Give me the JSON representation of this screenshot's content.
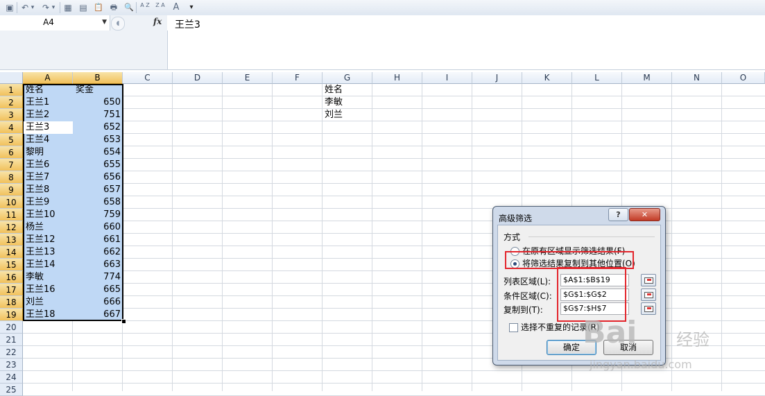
{
  "toolbar": {
    "icons": [
      "save-icon",
      "undo-icon",
      "undo-dropdown-icon",
      "redo-icon",
      "redo-dropdown-icon",
      "borders-icon",
      "form-icon",
      "paste-icon",
      "print-icon",
      "print-preview-icon",
      "sort-ascending-icon",
      "sort-descending-icon",
      "font-size-icon",
      "customize-icon"
    ],
    "glyphs": [
      "▣",
      "↶",
      "▾",
      "↷",
      "▾",
      "▦",
      "▤",
      "📋",
      "🖶",
      "🔍",
      "↓",
      "↓",
      "A",
      "▾"
    ],
    "sort_asc_label": "A Z",
    "sort_desc_label": "Z A",
    "font_label": "A"
  },
  "formula_bar": {
    "name_box": "A4",
    "fx_label": "fx",
    "content": "王兰3"
  },
  "grid": {
    "columns": [
      "A",
      "B",
      "C",
      "D",
      "E",
      "F",
      "G",
      "H",
      "I",
      "J",
      "K",
      "L",
      "M",
      "N",
      "O"
    ],
    "rows": [
      "1",
      "2",
      "3",
      "4",
      "5",
      "6",
      "7",
      "8",
      "9",
      "10",
      "11",
      "12",
      "13",
      "14",
      "15",
      "16",
      "17",
      "18",
      "19",
      "20",
      "21",
      "22",
      "23",
      "24",
      "25"
    ],
    "colA": [
      "姓名",
      "王兰1",
      "王兰2",
      "王兰3",
      "王兰4",
      "黎明",
      "王兰6",
      "王兰7",
      "王兰8",
      "王兰9",
      "王兰10",
      "杨兰",
      "王兰12",
      "王兰13",
      "王兰14",
      "李敏",
      "王兰16",
      "刘兰",
      "王兰18"
    ],
    "colB": [
      "奖金",
      "650",
      "751",
      "652",
      "653",
      "654",
      "655",
      "656",
      "657",
      "658",
      "759",
      "660",
      "661",
      "662",
      "663",
      "774",
      "665",
      "666",
      "667"
    ],
    "colG": [
      "姓名",
      "李敏",
      "刘兰"
    ]
  },
  "dialog": {
    "title": "高级筛选",
    "help": "?",
    "close": "✕",
    "section": "方式",
    "option1": "在原有区域显示筛选结果(F)",
    "option2": "将筛选结果复制到其他位置(O)",
    "list_label": "列表区域(L):",
    "list_value": "$A$1:$B$19",
    "criteria_label": "条件区域(C):",
    "criteria_value": "$G$1:$G$2",
    "copyto_label": "复制到(T):",
    "copyto_value": "$G$7:$H$7",
    "unique_label": "选择不重复的记录(R)",
    "ok": "确定",
    "cancel": "取消"
  },
  "watermark": {
    "brand": "Bai",
    "brand2": "经验",
    "url": "jingyan.baidu.com"
  }
}
